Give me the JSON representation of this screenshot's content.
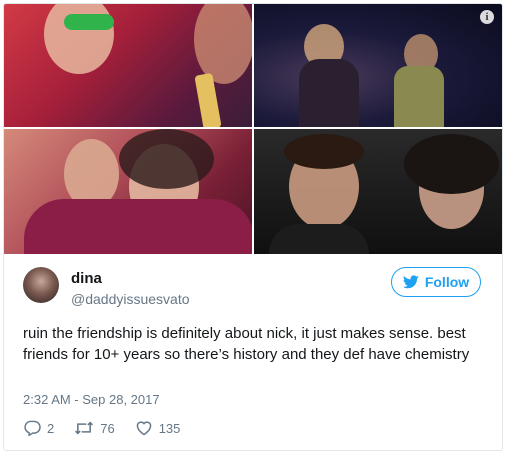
{
  "media": {
    "photos": [
      {
        "alt": "photo-1"
      },
      {
        "alt": "photo-2"
      },
      {
        "alt": "photo-3"
      },
      {
        "alt": "photo-4"
      }
    ],
    "info_icon": "info-icon"
  },
  "author": {
    "name": "dina",
    "handle": "@daddyissuesvato"
  },
  "follow": {
    "label": "Follow",
    "icon": "twitter-bird-icon"
  },
  "tweet": {
    "text": "ruin the friendship is definitely about nick, it just makes sense. best friends for 10+ years so there’s history and they def have chemistry",
    "timestamp": "2:32 AM - Sep 28, 2017"
  },
  "actions": {
    "replies": "2",
    "retweets": "76",
    "likes": "135"
  },
  "colors": {
    "accent": "#1da1f2",
    "muted": "#657786",
    "text": "#14171a"
  }
}
